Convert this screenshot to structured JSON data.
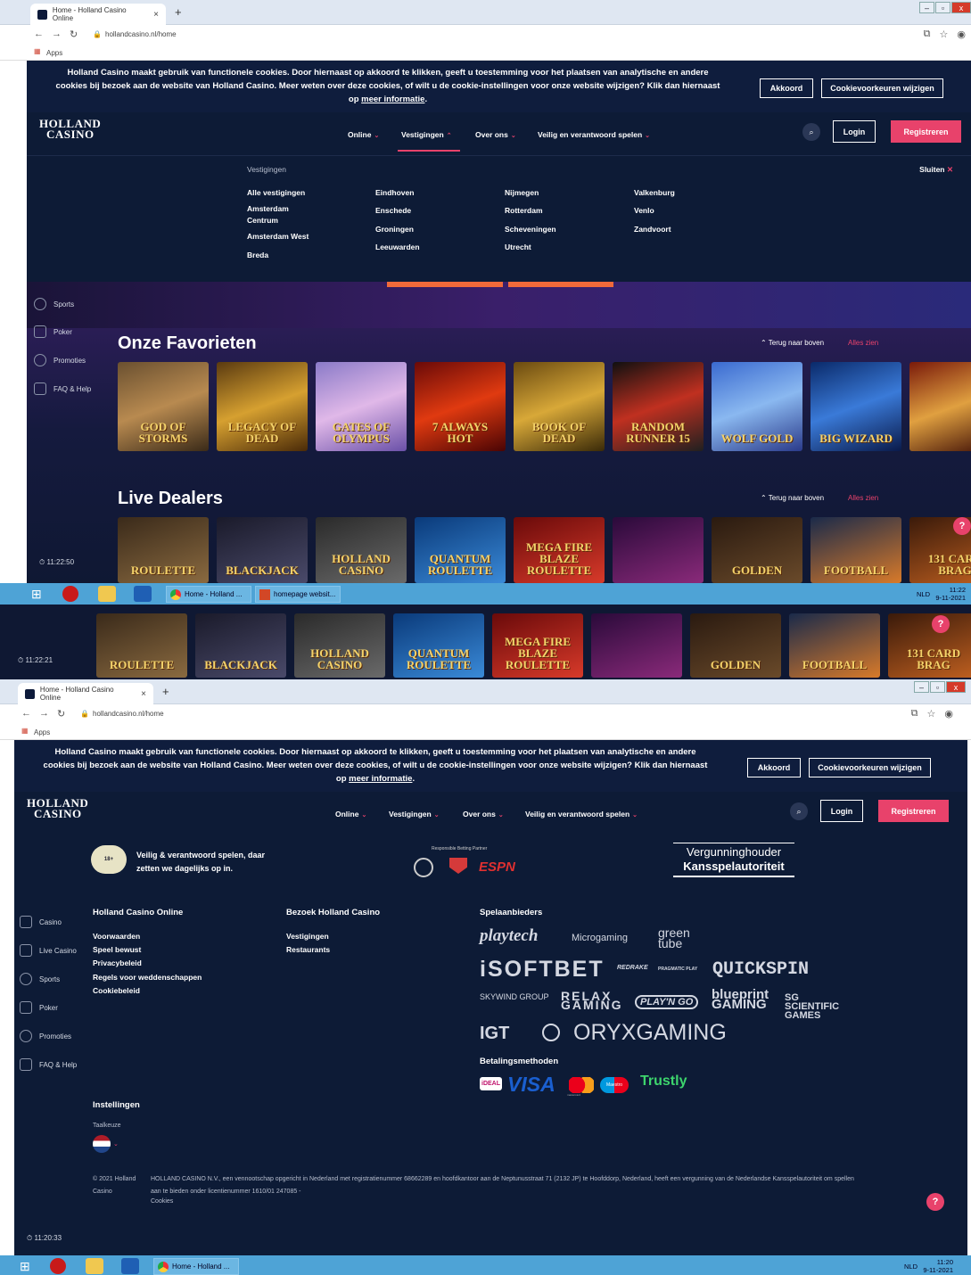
{
  "browser": {
    "tab_title": "Home - Holland Casino Online",
    "tab_close": "×",
    "new_tab": "+",
    "url": "hollandcasino.nl/home",
    "bookmarks_label": "Apps",
    "win_min": "–",
    "win_max": "▫",
    "win_close": "x"
  },
  "cookie_banner": {
    "text_line1": "Holland Casino maakt gebruik van functionele cookies. Door hiernaast op akkoord te klikken, geeft u toestemming voor het plaatsen van analytische en andere",
    "text_line2": "cookies bij bezoek aan de website van Holland Casino. Meer weten over deze cookies, of wilt u de cookie-instellingen voor onze website wijzigen? Klik dan hiernaast",
    "text_prefix": "op",
    "link": "meer informatie",
    "text_suffix": ".",
    "accept_label": "Akkoord",
    "prefs_label": "Cookievoorkeuren wijzigen"
  },
  "header": {
    "logo_line1": "HOLLAND",
    "logo_line2": "CASINO",
    "nav": [
      "Online",
      "Vestigingen",
      "Over ons",
      "Veilig en verantwoord spelen"
    ],
    "login_label": "Login",
    "register_label": "Registreren"
  },
  "dropdown": {
    "title": "Vestigingen",
    "close_label": "Sluiten",
    "columns": [
      [
        "Alle vestigingen",
        "Amsterdam Centrum",
        "Amsterdam West",
        "Breda"
      ],
      [
        "Eindhoven",
        "Enschede",
        "Groningen",
        "Leeuwarden"
      ],
      [
        "Nijmegen",
        "Rotterdam",
        "Scheveningen",
        "Utrecht"
      ],
      [
        "Valkenburg",
        "Venlo",
        "Zandvoort"
      ]
    ]
  },
  "sidebar_top": [
    "Sports",
    "Poker",
    "Promoties",
    "FAQ & Help"
  ],
  "sidebar_bottom": [
    "Casino",
    "Live Casino",
    "Sports",
    "Poker",
    "Promoties",
    "FAQ & Help"
  ],
  "favorites": {
    "title": "Onze Favorieten",
    "back_to_top": "Terug naar boven",
    "see_all": "Alles zien",
    "games": [
      "GOD OF STORMS",
      "LEGACY OF DEAD",
      "GATES OF OLYMPUS",
      "7 ALWAYS HOT",
      "BOOK OF DEAD",
      "RANDOM RUNNER 15",
      "WOLF GOLD",
      "BIG WIZARD",
      ""
    ]
  },
  "live_dealers": {
    "title": "Live Dealers",
    "back_to_top": "Terug naar boven",
    "see_all": "Alles zien",
    "games": [
      "ROULETTE",
      "BLACKJACK",
      "HOLLAND CASINO",
      "QUANTUM ROULETTE",
      "MEGA FIRE BLAZE ROULETTE",
      "",
      "GOLDEN",
      "FOOTBALL",
      "131 CARD BRAG"
    ]
  },
  "clocks": {
    "top": "11:22:50",
    "middle": "11:22:21",
    "bottom": "11:20:33"
  },
  "taskbar": {
    "app1": "Home - Holland ...",
    "app2": "homepage websit...",
    "lang": "NLD",
    "time_top": "11:22",
    "date_top": "9-11-2021",
    "time_bottom": "11:20",
    "date_bottom": "9-11-2021"
  },
  "footer": {
    "responsible_text": "Veilig & verantwoord spelen, daar zetten we dagelijks op in.",
    "partner_label": "Responsible Betting Partner",
    "espn": "ESPN",
    "license_line1": "Vergunninghouder",
    "license_line2": "Kansspelautoriteit",
    "col1_title": "Holland Casino Online",
    "col1_links": [
      "Voorwaarden",
      "Speel bewust",
      "Privacybeleid",
      "Regels voor weddenschappen",
      "Cookiebeleid"
    ],
    "col2_title": "Bezoek Holland Casino",
    "col2_links": [
      "Vestigingen",
      "Restaurants"
    ],
    "providers_title": "Spelaanbieders",
    "providers": [
      "playtech",
      "Microgaming",
      "green tube",
      "iSOFTBET",
      "REDRAKE",
      "PRAGMATIC PLAY",
      "QUICKSPIN",
      "SKYWIND GROUP",
      "RELAX GAMING",
      "PLAY'N GO",
      "blueprint GAMING",
      "SG SCIENTIFIC GAMES",
      "IGT",
      "ORYXGAMING"
    ],
    "payments_title": "Betalingsmethoden",
    "payments": [
      "iDEAL",
      "VISA",
      "mastercard",
      "Maestro",
      "Trustly"
    ],
    "settings_title": "Instellingen",
    "language_label": "Taalkeuze",
    "copyright_left": "© 2021 Holland Casino",
    "copyright_text": "HOLLAND CASINO N.V., een vennootschap opgericht in Nederland met registratienummer 68662289 en hoofdkantoor aan de Neptunusstraat 71 (2132 JP) te Hoofddorp, Nederland, heeft een vergunning van de Nederlandse Kansspelautoriteit om spellen aan te bieden onder licentienummer 1610/01 247085 -",
    "cookies_link": "Cookies"
  },
  "colors": {
    "accent": "#e8426b",
    "navy": "#0d1b36",
    "taskbar": "#4ea3d6"
  }
}
